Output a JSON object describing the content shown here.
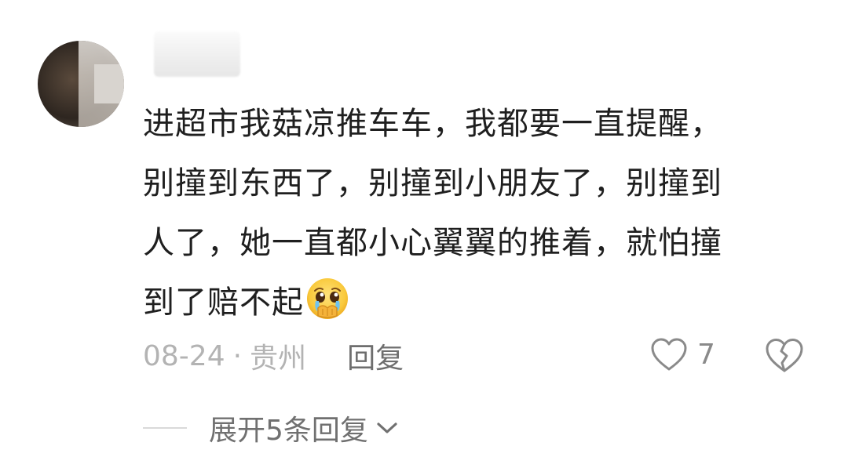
{
  "comment": {
    "lines": [
      "进超市我菇凉推车车，我都要一直提醒，",
      "别撞到东西了，别撞到小朋友了，别撞到",
      "人了，她一直都小心翼翼的推着，就怕撞",
      "到了赔不起"
    ],
    "emoji": "pleading-face-crying-emoji",
    "date": "08-24",
    "separator": "·",
    "location": "贵州",
    "reply_label": "回复",
    "like_count": "7"
  },
  "expand": {
    "label": "展开5条回复"
  },
  "colors": {
    "text": "#1f1f1f",
    "meta": "#b3b3b3",
    "reply": "#6e6e6e",
    "icon": "#8a8a8a"
  }
}
